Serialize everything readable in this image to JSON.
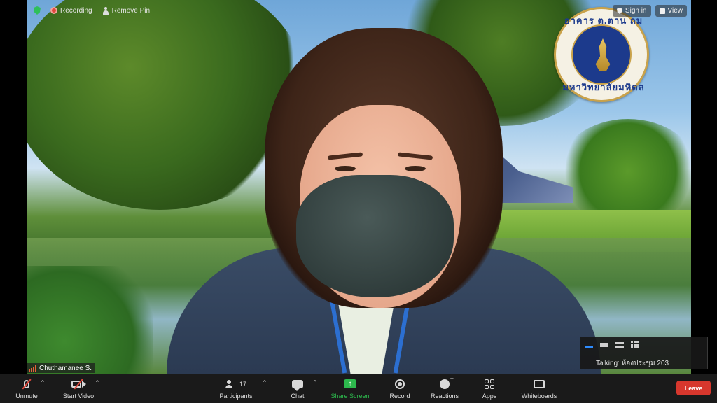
{
  "top_indicators": {
    "recording": "Recording",
    "remove_pin": "Remove Pin"
  },
  "top_right": {
    "sign_in": "Sign in",
    "view": "View"
  },
  "logo": {
    "top_text": "อาคาร ต.ตาน ถม",
    "bottom_text": "มหาวิทยาลัยมหิดล"
  },
  "participant": {
    "name": "Chuthamanee S."
  },
  "talking_panel": {
    "text": "Talking: ห้องประชุม 203"
  },
  "toolbar": {
    "unmute": "Unmute",
    "start_video": "Start Video",
    "participants": "Participants",
    "participants_count": "17",
    "chat": "Chat",
    "share_screen": "Share Screen",
    "record": "Record",
    "reactions": "Reactions",
    "apps": "Apps",
    "whiteboards": "Whiteboards",
    "leave": "Leave"
  },
  "colors": {
    "share_green": "#2db84d",
    "leave_red": "#d7372d",
    "toolbar_bg": "#1a1a1a"
  }
}
